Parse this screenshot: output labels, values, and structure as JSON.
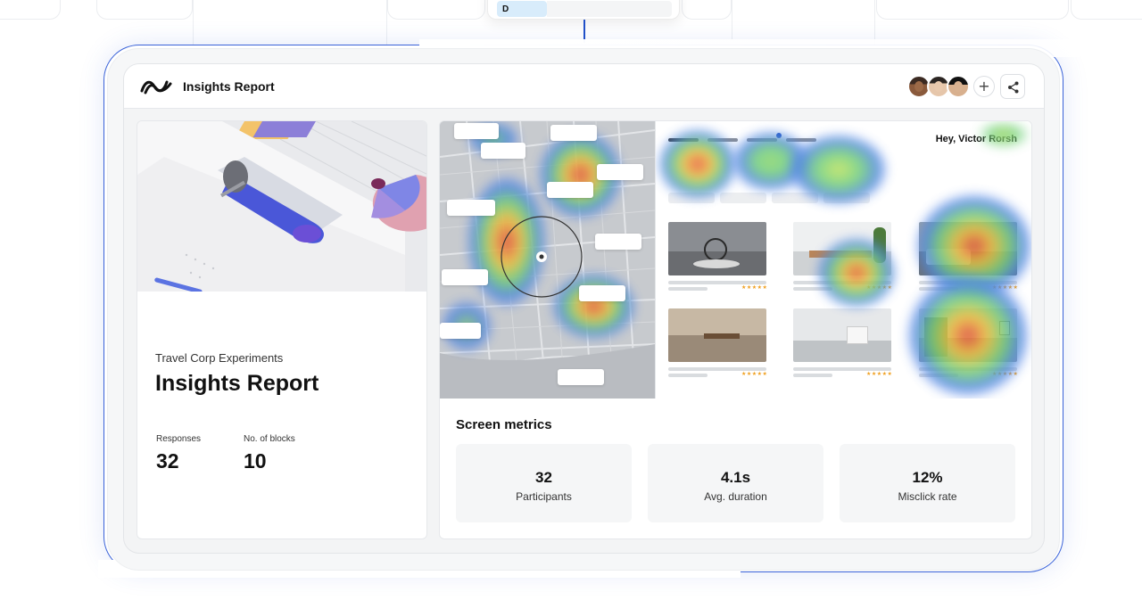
{
  "app": {
    "title": "Insights Report"
  },
  "background": {
    "dropdown_option": "D"
  },
  "report": {
    "subtitle": "Travel Corp Experiments",
    "title": "Insights Report",
    "stats": [
      {
        "label": "Responses",
        "value": "32"
      },
      {
        "label": "No. of blocks",
        "value": "10"
      }
    ]
  },
  "prototype": {
    "greeting": "Hey, Victor Rorsh"
  },
  "metrics": {
    "title": "Screen metrics",
    "items": [
      {
        "value": "32",
        "label": "Participants"
      },
      {
        "value": "4.1s",
        "label": "Avg. duration"
      },
      {
        "value": "12%",
        "label": "Misclick rate"
      }
    ]
  },
  "colors": {
    "accent": "#2150c8",
    "rating": "#f0a020"
  },
  "icons": [
    "logo-icon",
    "plus-icon",
    "share-icon"
  ]
}
